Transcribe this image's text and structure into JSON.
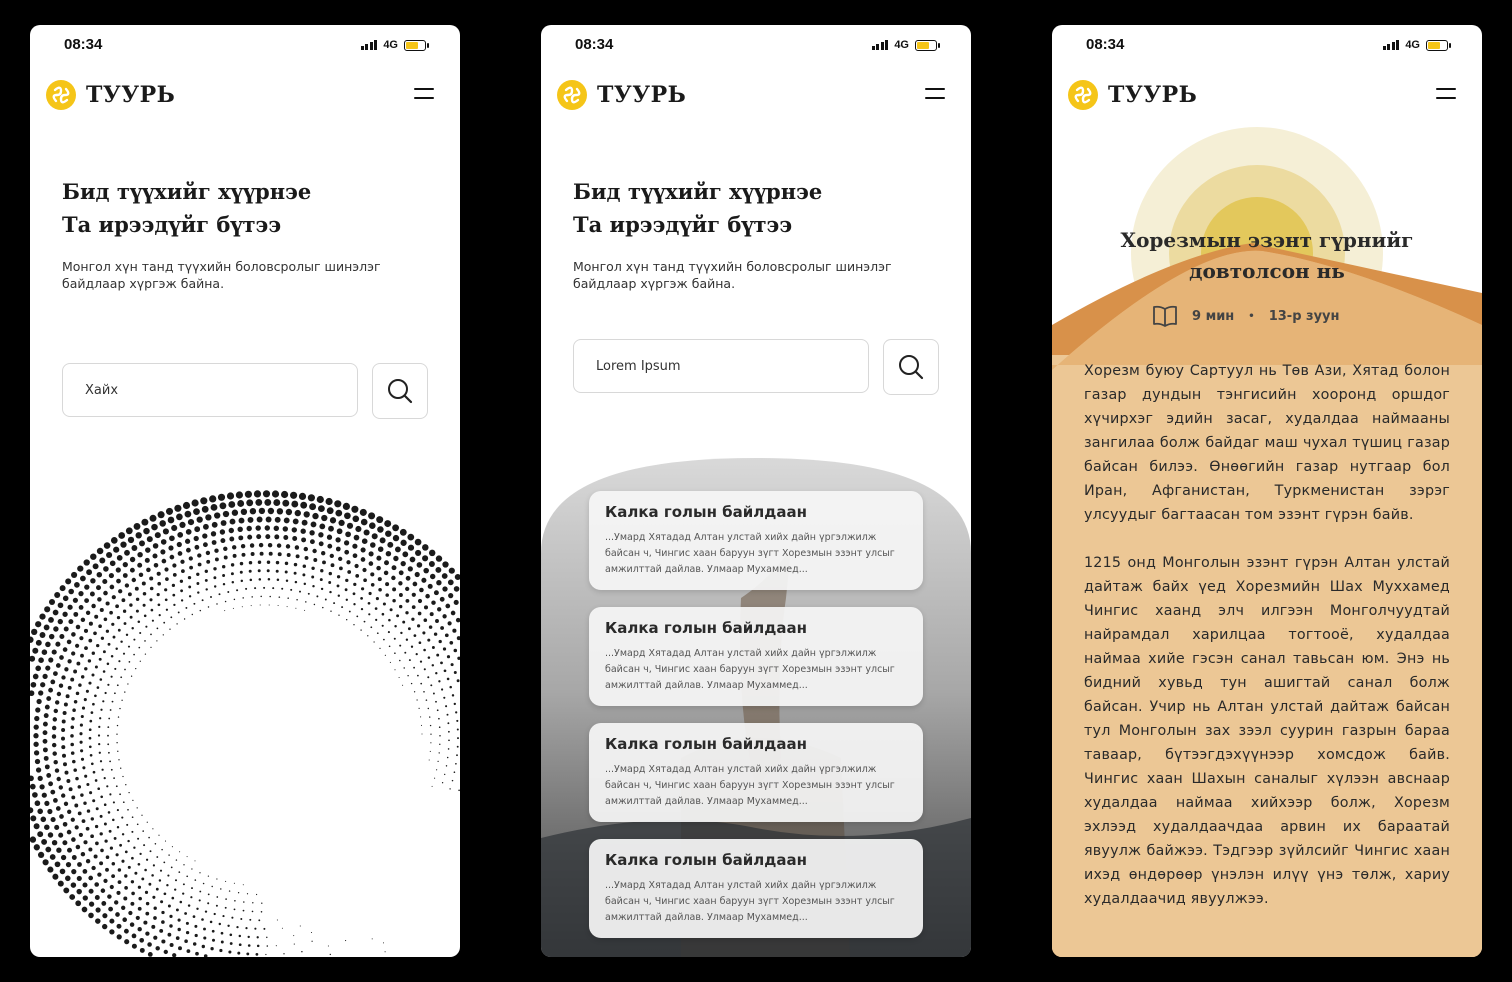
{
  "status": {
    "time": "08:34",
    "network": "4G"
  },
  "brand": {
    "name": "ТУУРЬ"
  },
  "hero": {
    "title_line1": "Бид түүхийг хүүрнэе",
    "title_line2": "Та ирээдүйг бүтээ",
    "subtitle": "Монгол хүн танд түүхийн боловсролыг шинэлэг байдлаар хүргэж байна."
  },
  "screen1": {
    "search_placeholder": "Хайх"
  },
  "screen2": {
    "search_value": "Lorem Ipsum",
    "results": [
      {
        "title": "Калка голын байлдаан",
        "excerpt": "...Умард Хятадад Алтан улстай хийх дайн үргэлжилж байсан ч, Чингис хаан баруун зүгт Хорезмын эзэнт улсыг амжилттай дайлав. Улмаар Мухаммед..."
      },
      {
        "title": "Калка голын байлдаан",
        "excerpt": "...Умард Хятадад Алтан улстай хийх дайн үргэлжилж байсан ч, Чингис хаан баруун зүгт Хорезмын эзэнт улсыг амжилттай дайлав. Улмаар Мухаммед..."
      },
      {
        "title": "Калка голын байлдаан",
        "excerpt": "...Умард Хятадад Алтан улстай хийх дайн үргэлжилж байсан ч, Чингис хаан баруун зүгт Хорезмын эзэнт улсыг амжилттай дайлав. Улмаар Мухаммед..."
      },
      {
        "title": "Калка голын байлдаан",
        "excerpt": "...Умард Хятадад Алтан улстай хийх дайн үргэлжилж байсан ч, Чингис хаан баруун зүгт Хорезмын эзэнт улсыг амжилттай дайлав. Улмаар Мухаммед..."
      }
    ]
  },
  "screen3": {
    "title_line1": "Хорезмын эзэнт гүрнийг",
    "title_line2": "довтолсон нь",
    "read_time": "9 мин",
    "era": "13-р зуун",
    "paragraph1": "Хорезм буюу Сартуул нь Төв Ази, Хятад болон газар дундын тэнгисийн хооронд оршдог хүчирхэг эдийн засаг, худалдаа наймааны зангилаа болж байдаг маш чухал түшиц газар байсан билээ. Өнөөгийн газар нутгаар бол Иран, Афганистан, Туркменистан зэрэг улсуудыг багтаасан том эзэнт гүрэн байв.",
    "paragraph2": "1215 онд Монголын эзэнт гүрэн Алтан улстай дайтаж байх үед Хорезмийн Шах Муххамед Чингис хаанд элч илгээн Монголчуудтай найрамдал харилцаа тогтооё, худалдаа наймаа хийе гэсэн санал тавьсан юм. Энэ нь бидний хувьд тун ашигтай санал болж байсан. Учир нь Алтан улстай дайтаж байсан тул Монголын зах зээл суурин газрын бараа таваар, бүтээгдэхүүнээр хомсдож байв. Чингис хаан Шахын саналыг хүлээн авснаар худалдаа наймаа хийхээр болж, Хорезм эхлээд худалдаачдаа арвин их бараатай явуулж байжээ. Тэдгээр зүйлсийг Чингис хаан ихэд өндөрөөр үнэлэн илүү үнэ төлж, хариу худалдаачид явуулжээ."
  },
  "colors": {
    "accent": "#f5c518",
    "sand": "#ecc795",
    "dune": "#d8914a",
    "sun": "#e3c85c"
  }
}
